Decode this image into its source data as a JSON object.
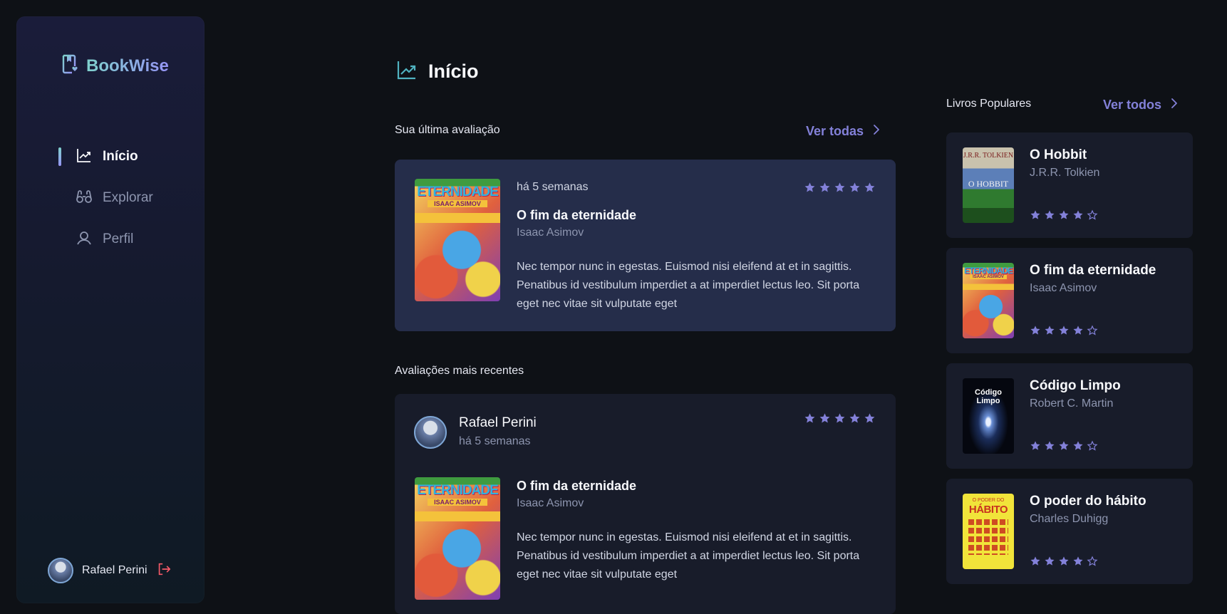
{
  "app": {
    "name": "BookWise"
  },
  "colors": {
    "accent": "#8381d9",
    "gradient_start": "#7fd1cc",
    "gradient_end": "#9694f5",
    "star": "#8381d9",
    "logout": "#f75a68"
  },
  "sidebar": {
    "items": [
      {
        "label": "Início",
        "icon": "chart-line-up-icon",
        "active": true
      },
      {
        "label": "Explorar",
        "icon": "binoculars-icon",
        "active": false
      },
      {
        "label": "Perfil",
        "icon": "user-icon",
        "active": false
      }
    ],
    "user": {
      "name": "Rafael Perini",
      "logout_icon": "sign-out-icon"
    }
  },
  "main": {
    "title": "Início",
    "last_review": {
      "section_label": "Sua última avaliação",
      "link": "Ver todas",
      "time": "há 5 semanas",
      "rating": 5,
      "book": {
        "title": "O fim da eternidade",
        "author": "Isaac Asimov",
        "cover_title": "ETERNIDADE",
        "cover_author": "ISAAC ASIMOV"
      },
      "description": "Nec tempor nunc in egestas. Euismod nisi eleifend at et in sagittis. Penatibus id vestibulum imperdiet a at imperdiet lectus leo. Sit porta eget nec vitae sit vulputate eget"
    },
    "recent": {
      "section_label": "Avaliações mais recentes",
      "reviews": [
        {
          "user": "Rafael Perini",
          "time": "há 5 semanas",
          "rating": 5,
          "book": {
            "title": "O fim da eternidade",
            "author": "Isaac Asimov",
            "cover_title": "ETERNIDADE",
            "cover_author": "ISAAC ASIMOV"
          },
          "description": "Nec tempor nunc in egestas. Euismod nisi eleifend at et in sagittis. Penatibus id vestibulum imperdiet a at imperdiet lectus leo. Sit porta eget nec vitae sit vulputate eget"
        }
      ]
    }
  },
  "popular": {
    "label": "Livros Populares",
    "link": "Ver todos",
    "books": [
      {
        "title": "O Hobbit",
        "author": "J.R.R. Tolkien",
        "rating": 4,
        "cover_text": [
          "J.R.R. TOLKIEN",
          "O HOBBIT"
        ]
      },
      {
        "title": "O fim da eternidade",
        "author": "Isaac Asimov",
        "rating": 4,
        "cover_text": [
          "ETERNIDADE",
          "ISAAC ASIMOV"
        ]
      },
      {
        "title": "Código Limpo",
        "author": "Robert C. Martin",
        "rating": 4,
        "cover_text": [
          "Código Limpo"
        ]
      },
      {
        "title": "O poder do hábito",
        "author": "Charles Duhigg",
        "rating": 4,
        "cover_text": [
          "O PODER DO",
          "HÁBITO"
        ]
      }
    ]
  }
}
